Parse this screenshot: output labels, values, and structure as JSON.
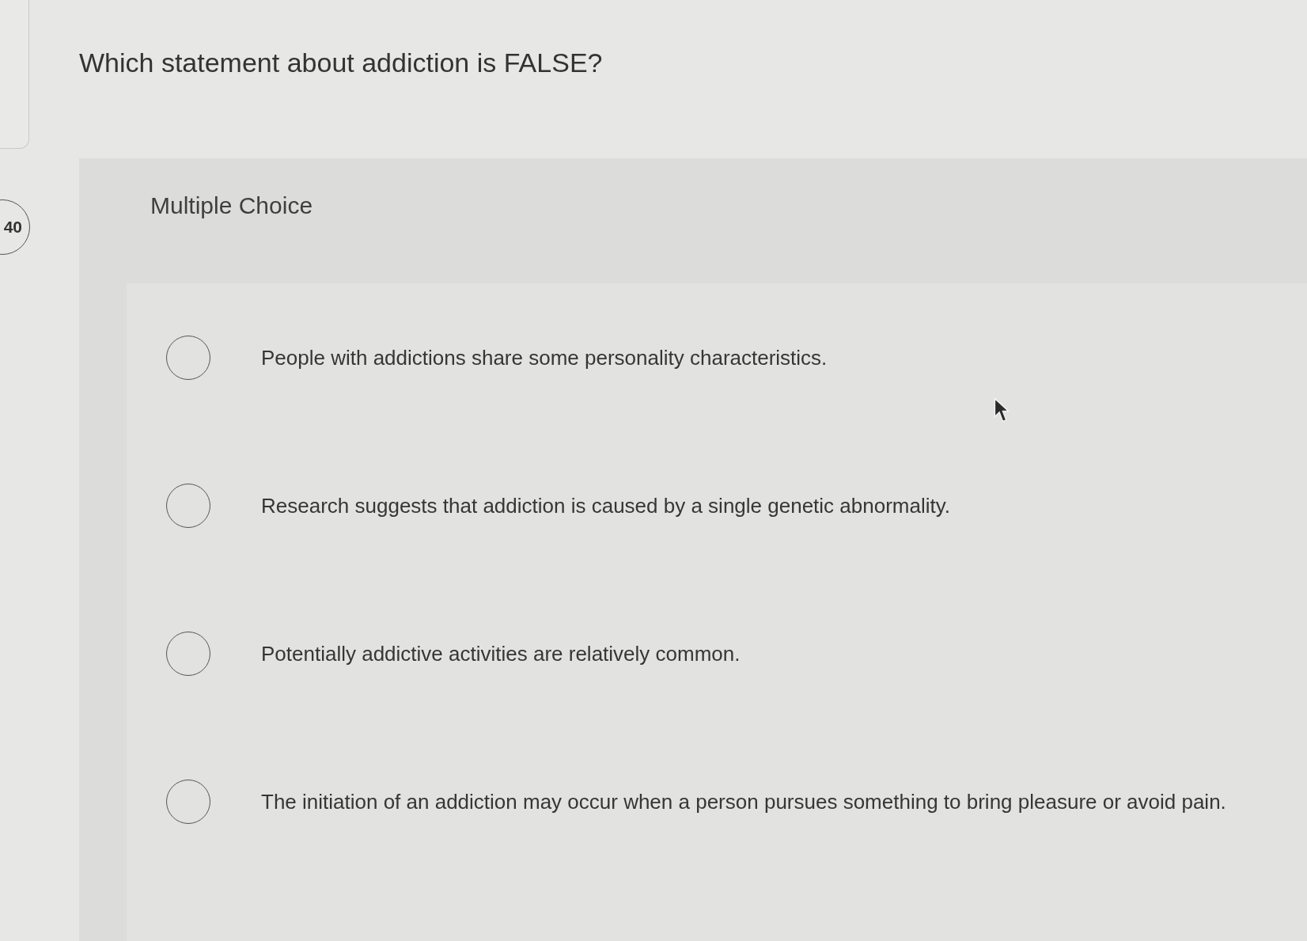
{
  "question": {
    "number": "40",
    "text": "Which statement about addiction is FALSE?"
  },
  "question_type": "Multiple Choice",
  "options": [
    {
      "text": "People with addictions share some personality characteristics.",
      "selected": false
    },
    {
      "text": "Research suggests that addiction is caused by a single genetic abnormality.",
      "selected": false
    },
    {
      "text": "Potentially addictive activities are relatively common.",
      "selected": false
    },
    {
      "text": "The initiation of an addiction may occur when a person pursues something to bring pleasure or avoid pain.",
      "selected": false
    }
  ]
}
